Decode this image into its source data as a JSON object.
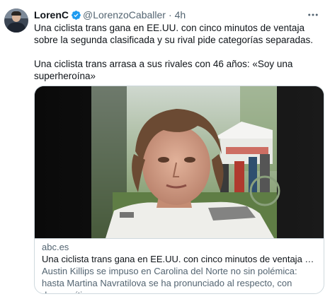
{
  "tweet": {
    "display_name": "LorenC",
    "handle": "@LorenzoCaballer",
    "separator": "·",
    "time": "4h",
    "more_icon": "more-horizontal-icon",
    "verified_color": "#1d9bf0",
    "paragraphs": [
      "Una ciclista trans gana en EE.UU. con cinco minutos de ventaja sobre la segunda clasificada y su rival pide categorías separadas.",
      "Una ciclista trans arrasa a sus rivales con 46 años: «Soy una superheroína»"
    ]
  },
  "card": {
    "domain": "abc.es",
    "title": "Una ciclista trans gana en EE.UU. con cinco minutos de ventaja sobre ...",
    "description": "Austin Killips se impuso en Carolina del Norte no sin polémica: hasta Martina Navratilova se ha pronunciado al respecto, con duras críticas"
  }
}
